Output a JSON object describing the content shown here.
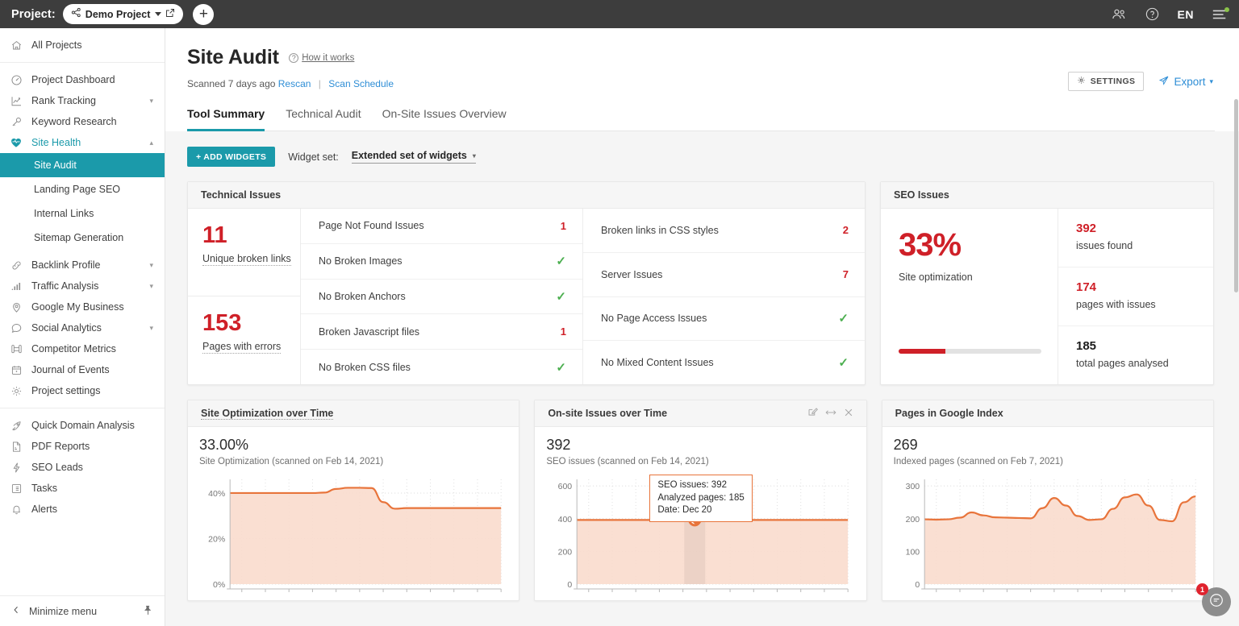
{
  "topbar": {
    "project_label": "Project:",
    "project_name": "Demo Project",
    "add_label": "+",
    "language": "EN",
    "icons": {
      "team": "team-icon",
      "help": "help-icon",
      "menu": "menu-icon"
    }
  },
  "sidebar": {
    "all_projects": "All Projects",
    "items": [
      {
        "label": "Project Dashboard",
        "icon": "speedometer-icon",
        "expandable": false
      },
      {
        "label": "Rank Tracking",
        "icon": "chart-line-icon",
        "expandable": true
      },
      {
        "label": "Keyword Research",
        "icon": "key-icon",
        "expandable": false
      },
      {
        "label": "Site Health",
        "icon": "heartbeat-icon",
        "expandable": true,
        "active": true
      }
    ],
    "sub_items": [
      {
        "label": "Site Audit",
        "selected": true
      },
      {
        "label": "Landing Page SEO",
        "selected": false
      },
      {
        "label": "Internal Links",
        "selected": false
      },
      {
        "label": "Sitemap Generation",
        "selected": false
      }
    ],
    "items2": [
      {
        "label": "Backlink Profile",
        "icon": "link-icon",
        "expandable": true
      },
      {
        "label": "Traffic Analysis",
        "icon": "bars-icon",
        "expandable": true
      },
      {
        "label": "Google My Business",
        "icon": "pin-icon",
        "expandable": false
      },
      {
        "label": "Social Analytics",
        "icon": "chat-bubble-icon",
        "expandable": true
      },
      {
        "label": "Competitor Metrics",
        "icon": "binoculars-icon",
        "expandable": false
      },
      {
        "label": "Journal of Events",
        "icon": "calendar-icon",
        "expandable": false
      },
      {
        "label": "Project settings",
        "icon": "gear-icon",
        "expandable": false
      }
    ],
    "items3": [
      {
        "label": "Quick Domain Analysis",
        "icon": "rocket-icon"
      },
      {
        "label": "PDF Reports",
        "icon": "pdf-file-icon"
      },
      {
        "label": "SEO Leads",
        "icon": "bolt-icon"
      },
      {
        "label": "Tasks",
        "icon": "list-icon"
      },
      {
        "label": "Alerts",
        "icon": "bell-icon"
      }
    ],
    "minimize": "Minimize menu"
  },
  "header": {
    "title": "Site Audit",
    "how_it_works": "How it works",
    "scanned": "Scanned 7 days ago",
    "rescan": "Rescan",
    "scan_schedule": "Scan Schedule",
    "settings": "SETTINGS",
    "export": "Export"
  },
  "tabs": [
    {
      "label": "Tool Summary",
      "active": true
    },
    {
      "label": "Technical Audit",
      "active": false
    },
    {
      "label": "On-Site Issues Overview",
      "active": false
    }
  ],
  "toolbar": {
    "add_widgets": "+ ADD WIDGETS",
    "widget_set_label": "Widget set:",
    "widget_set_value": "Extended set of widgets"
  },
  "technical_issues": {
    "title": "Technical Issues",
    "kpis": [
      {
        "value": "11",
        "label": "Unique broken links"
      },
      {
        "value": "153",
        "label": "Pages with errors"
      }
    ],
    "col_mid": [
      {
        "label": "Page Not Found Issues",
        "value": "1",
        "ok": false
      },
      {
        "label": "No Broken Images",
        "value": "",
        "ok": true
      },
      {
        "label": "No Broken Anchors",
        "value": "",
        "ok": true
      },
      {
        "label": "Broken Javascript files",
        "value": "1",
        "ok": false
      },
      {
        "label": "No Broken CSS files",
        "value": "",
        "ok": true
      }
    ],
    "col_right": [
      {
        "label": "Broken links in CSS styles",
        "value": "2",
        "ok": false
      },
      {
        "label": "Server Issues",
        "value": "7",
        "ok": false
      },
      {
        "label": "No Page Access Issues",
        "value": "",
        "ok": true
      },
      {
        "label": "No Mixed Content Issues",
        "value": "",
        "ok": true
      }
    ]
  },
  "seo_issues": {
    "title": "SEO Issues",
    "percent": "33%",
    "percent_label": "Site optimization",
    "progress_value": 33,
    "stats": [
      {
        "value": "392",
        "label": "issues found",
        "red": true
      },
      {
        "value": "174",
        "label": "pages with issues",
        "red": true
      },
      {
        "value": "185",
        "label": "total pages analysed",
        "red": false
      }
    ]
  },
  "widgets": [
    {
      "title": "Site Optimization over Time",
      "title_dotted": true,
      "big": "33.00%",
      "sub": "Site Optimization (scanned on Feb 14, 2021)",
      "has_controls": false
    },
    {
      "title": "On-site Issues over Time",
      "title_dotted": false,
      "big": "392",
      "sub": "SEO issues (scanned on Feb 14, 2021)",
      "has_controls": true,
      "controls": [
        "edit-icon",
        "resize-icon",
        "close-icon"
      ],
      "tooltip": [
        "SEO issues: 392",
        "Analyzed pages: 185",
        "Date: Dec 20"
      ]
    },
    {
      "title": "Pages in Google Index",
      "title_dotted": false,
      "big": "269",
      "sub": "Indexed pages (scanned on Feb 7, 2021)",
      "has_controls": false
    }
  ],
  "chat": {
    "badge": "1",
    "icon": "chat-bubble-icon"
  },
  "colors": {
    "accent": "#1b9aaa",
    "danger": "#cf2028",
    "ok": "#4caf50",
    "link": "#2f8ed6",
    "chart_line": "#e8743b",
    "chart_fill": "#fadccd",
    "topbar": "#3d3d3d"
  },
  "chart_data": [
    {
      "type": "area",
      "title": "Site Optimization over Time",
      "ylabel": "Site Optimization",
      "ytick_labels": [
        "0%",
        "20%",
        "40%"
      ],
      "yticks": [
        0,
        20,
        40
      ],
      "ylim": [
        0,
        46
      ],
      "grid": true,
      "legend": "none",
      "x": [
        0,
        1,
        2,
        3,
        4,
        5,
        6,
        7,
        8,
        9,
        10,
        11,
        12,
        13,
        14,
        15,
        16,
        17,
        18,
        19,
        20,
        21,
        22,
        23
      ],
      "values": [
        40,
        40,
        40,
        40,
        40,
        40,
        40,
        40,
        40.2,
        41.8,
        42.3,
        42.3,
        42.2,
        36,
        33.1,
        33.4,
        33.4,
        33.4,
        33.4,
        33.4,
        33.4,
        33.4,
        33.4,
        33.4
      ],
      "current_value": 33.0
    },
    {
      "type": "area",
      "title": "On-site Issues over Time",
      "ylabel": "SEO issues",
      "ytick_labels": [
        "0",
        "200",
        "400",
        "600"
      ],
      "yticks": [
        0,
        200,
        400,
        600
      ],
      "ylim": [
        0,
        640
      ],
      "grid": true,
      "legend": "none",
      "x": [
        0,
        1,
        2,
        3,
        4,
        5,
        6,
        7,
        8,
        9,
        10,
        11,
        12,
        13,
        14,
        15,
        16,
        17,
        18,
        19,
        20,
        21,
        22,
        23
      ],
      "values": [
        392,
        392,
        392,
        392,
        392,
        392,
        392,
        392,
        392,
        392,
        392,
        392,
        392,
        392,
        392,
        392,
        392,
        392,
        392,
        392,
        392,
        392,
        392,
        392
      ],
      "highlight_index": 10,
      "current_value": 392,
      "annotation": {
        "seo_issues": 392,
        "analyzed_pages": 185,
        "date": "Dec 20"
      }
    },
    {
      "type": "area",
      "title": "Pages in Google Index",
      "ylabel": "Indexed pages",
      "ytick_labels": [
        "0",
        "100",
        "200",
        "300"
      ],
      "yticks": [
        0,
        100,
        200,
        300
      ],
      "ylim": [
        0,
        320
      ],
      "grid": true,
      "legend": "none",
      "x": [
        0,
        1,
        2,
        3,
        4,
        5,
        6,
        7,
        8,
        9,
        10,
        11,
        12,
        13,
        14,
        15,
        16,
        17,
        18,
        19,
        20,
        21,
        22,
        23
      ],
      "values": [
        198,
        197,
        198,
        203,
        219,
        210,
        204,
        203,
        202,
        201,
        232,
        263,
        240,
        208,
        196,
        198,
        230,
        265,
        274,
        240,
        196,
        192,
        250,
        268
      ],
      "current_value": 269
    }
  ]
}
